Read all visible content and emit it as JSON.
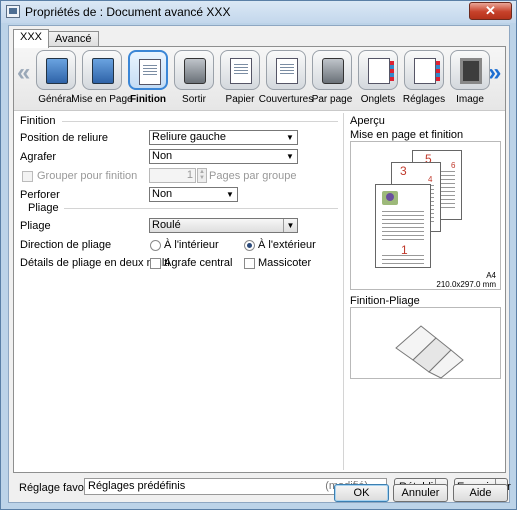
{
  "window": {
    "title": "Propriétés de : Document avancé XXX",
    "close_glyph": "✕"
  },
  "tabs": [
    {
      "label": "XXX"
    },
    {
      "label": "Avancé"
    }
  ],
  "iconbar": {
    "left_arrow": "«",
    "right_arrow": "»",
    "items": [
      {
        "label": "Général",
        "icon": "general-icon"
      },
      {
        "label": "Mise en Page",
        "icon": "layout-icon"
      },
      {
        "label": "Finition",
        "icon": "finishing-icon",
        "selected": true
      },
      {
        "label": "Sortir",
        "icon": "output-icon"
      },
      {
        "label": "Papier",
        "icon": "paper-icon"
      },
      {
        "label": "Couvertures",
        "icon": "covers-icon"
      },
      {
        "label": "Par page",
        "icon": "per-page-icon"
      },
      {
        "label": "Onglets",
        "icon": "tabs-icon"
      },
      {
        "label": "Réglages",
        "icon": "settings-icon"
      },
      {
        "label": "Image",
        "icon": "image-icon"
      }
    ]
  },
  "finition": {
    "title": "Finition",
    "binding_position": {
      "label": "Position de reliure",
      "value": "Reliure gauche"
    },
    "staple": {
      "label": "Agrafer",
      "value": "Non"
    },
    "group_finish": {
      "label": "Grouper pour finition",
      "count": "1",
      "unit": "Pages par groupe"
    },
    "punch": {
      "label": "Perforer",
      "value": "Non"
    }
  },
  "pliage": {
    "title": "Pliage",
    "fold": {
      "label": "Pliage",
      "value": "Roulé"
    },
    "direction": {
      "label": "Direction de pliage",
      "inside": "À l'intérieur",
      "outside": "À l'extérieur",
      "selected": "outside"
    },
    "details": {
      "label": "Détails de pliage en deux multi",
      "center_staple": "Agrafe central",
      "trimmer": "Massicoter"
    }
  },
  "preview": {
    "title": "Aperçu",
    "layout_label": "Mise en page et finition",
    "page_numbers": [
      "1",
      "3",
      "5",
      "4",
      "6"
    ],
    "paper_size": "A4",
    "paper_dims": "210.0x297.0 mm",
    "fold_label": "Finition-Pliage"
  },
  "footer": {
    "fav_label": "Réglage favori",
    "fav_value": "Réglages prédéfinis",
    "fav_modified": "(modifié)",
    "restore": "Rétablir",
    "save": "Enregistrer",
    "ok": "OK",
    "cancel": "Annuler",
    "help": "Aide"
  },
  "colors": {
    "accent": "#3b86d6",
    "titlebar": "#c3d7ec",
    "close": "#c7412a"
  }
}
